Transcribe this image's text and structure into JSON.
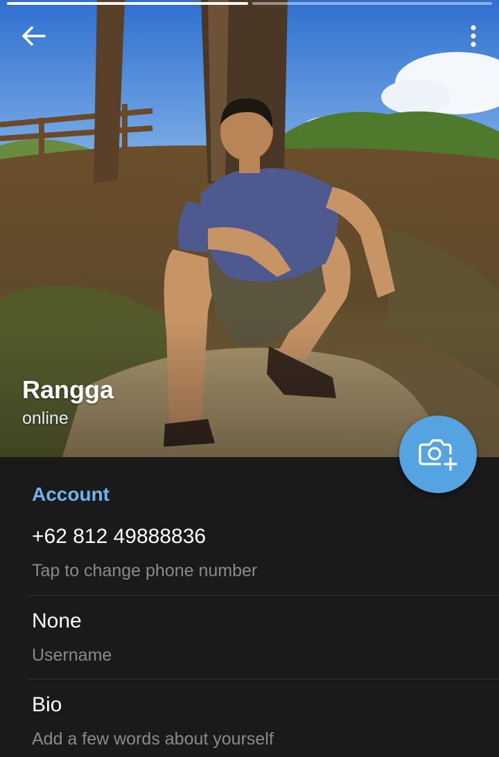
{
  "profile": {
    "name": "Rangga",
    "status": "online"
  },
  "story": {
    "segments": 2,
    "active_index": 0
  },
  "toolbar": {
    "back_icon": "arrow-left-icon",
    "menu_icon": "more-vertical-icon"
  },
  "fab": {
    "icon": "camera-add-icon",
    "color": "#55a3e0"
  },
  "account": {
    "section_title": "Account",
    "phone": {
      "value": "+62 812 49888836",
      "hint": "Tap to change phone number"
    },
    "username": {
      "value": "None",
      "hint": "Username"
    },
    "bio": {
      "value": "Bio",
      "hint": "Add a few words about yourself"
    }
  },
  "colors": {
    "accent": "#6fb3f0",
    "background": "#1a1a1a",
    "hint_text": "#8a8a8a"
  }
}
